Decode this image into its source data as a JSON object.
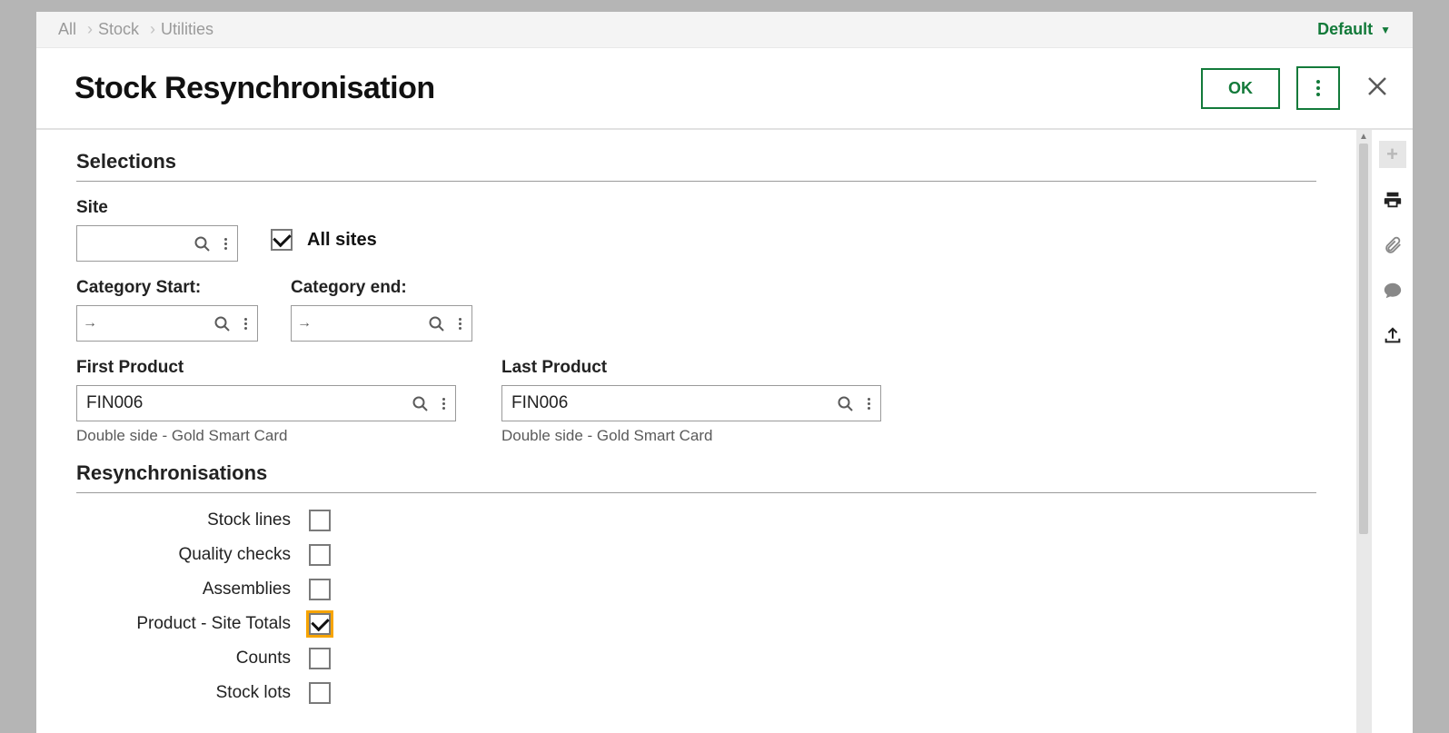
{
  "breadcrumb": {
    "items": [
      "All",
      "Stock",
      "Utilities"
    ]
  },
  "mode": {
    "label": "Default"
  },
  "header": {
    "title": "Stock Resynchronisation",
    "ok": "OK"
  },
  "selections": {
    "title": "Selections",
    "site_label": "Site",
    "site_value": "",
    "all_sites_label": "All sites",
    "all_sites_checked": true,
    "category_start_label": "Category Start:",
    "category_start_value": "",
    "category_end_label": "Category end:",
    "category_end_value": "",
    "first_product_label": "First Product",
    "first_product_value": "FIN006",
    "first_product_helper": "Double side - Gold Smart Card",
    "last_product_label": "Last Product",
    "last_product_value": "FIN006",
    "last_product_helper": "Double side - Gold Smart Card"
  },
  "resync": {
    "title": "Resynchronisations",
    "items": [
      {
        "label": "Stock lines",
        "checked": false
      },
      {
        "label": "Quality checks",
        "checked": false
      },
      {
        "label": "Assemblies",
        "checked": false
      },
      {
        "label": "Product - Site Totals",
        "checked": true,
        "focused": true
      },
      {
        "label": "Counts",
        "checked": false
      },
      {
        "label": "Stock lots",
        "checked": false
      }
    ]
  }
}
